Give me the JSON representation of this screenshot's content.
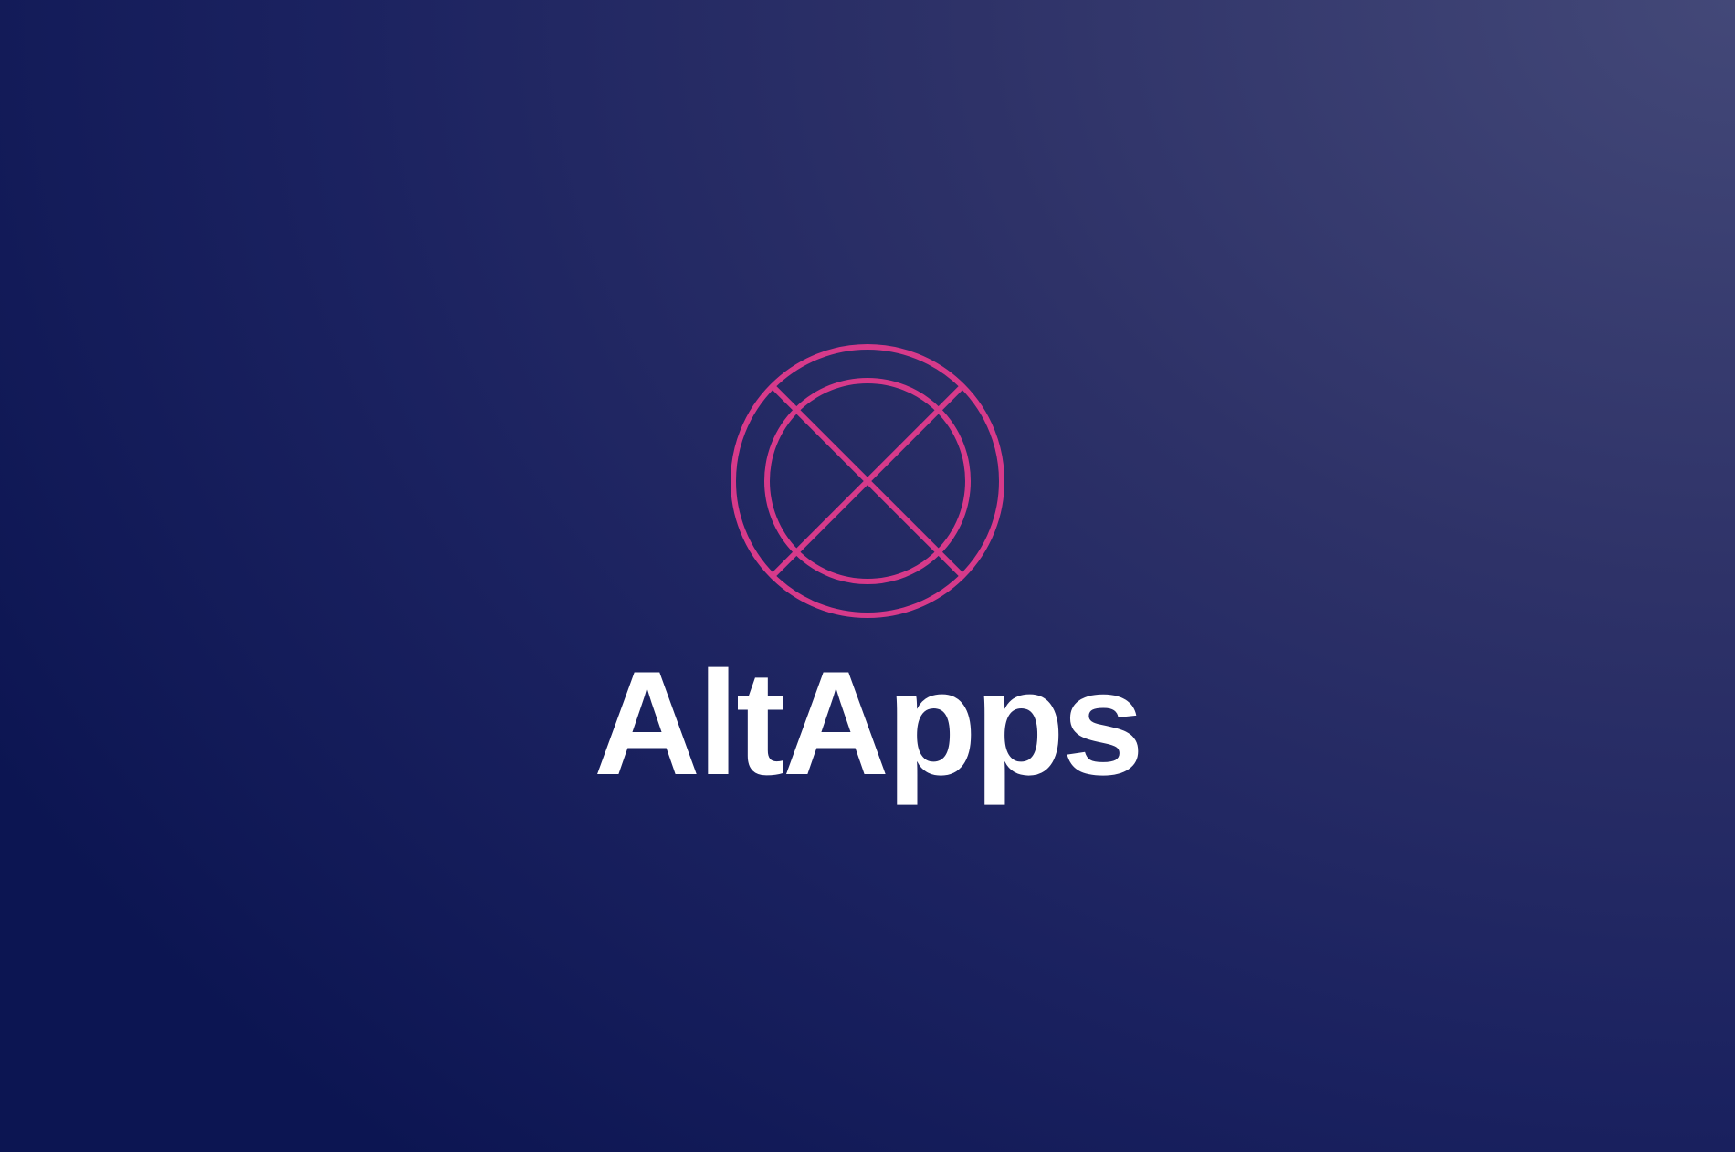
{
  "brand": {
    "name": "AltApps",
    "logo_icon": "circle-cross-logo-icon",
    "colors": {
      "background_dark": "#0c1552",
      "background_light": "#434878",
      "logo_accent": "#d63a8a",
      "wordmark": "#ffffff"
    }
  }
}
